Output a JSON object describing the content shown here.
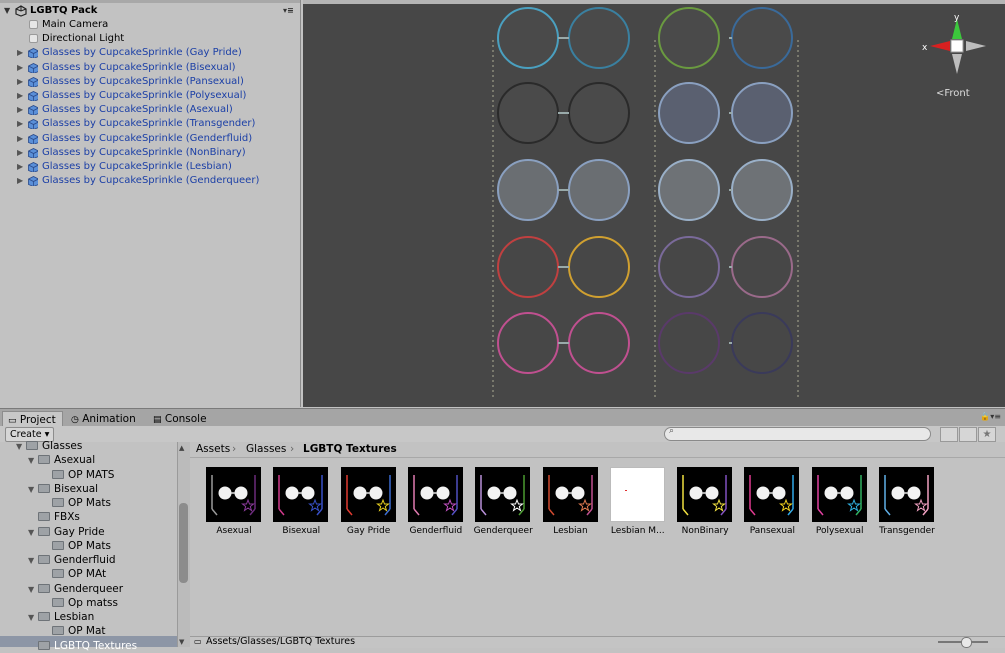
{
  "hierarchy": {
    "root": "LGBTQ Pack",
    "items": [
      {
        "label": "Main Camera",
        "prefab": false
      },
      {
        "label": "Directional Light",
        "prefab": false
      },
      {
        "label": "Glasses by CupcakeSprinkle (Gay Pride)",
        "prefab": true
      },
      {
        "label": "Glasses by CupcakeSprinkle (Bisexual)",
        "prefab": true
      },
      {
        "label": "Glasses by CupcakeSprinkle (Pansexual)",
        "prefab": true
      },
      {
        "label": "Glasses by CupcakeSprinkle (Polysexual)",
        "prefab": true
      },
      {
        "label": "Glasses by CupcakeSprinkle (Asexual)",
        "prefab": true
      },
      {
        "label": "Glasses by CupcakeSprinkle (Transgender)",
        "prefab": true
      },
      {
        "label": "Glasses by CupcakeSprinkle (Genderfluid)",
        "prefab": true
      },
      {
        "label": "Glasses by CupcakeSprinkle (NonBinary)",
        "prefab": true
      },
      {
        "label": "Glasses by CupcakeSprinkle (Lesbian)",
        "prefab": true
      },
      {
        "label": "Glasses by CupcakeSprinkle (Genderqueer)",
        "prefab": true
      }
    ]
  },
  "scene": {
    "gizmo": {
      "x": "x",
      "y": "y",
      "view": "Front"
    }
  },
  "tabs": [
    {
      "label": "Project",
      "active": true,
      "icon": "folder-icon"
    },
    {
      "label": "Animation",
      "active": false,
      "icon": "clock-icon"
    },
    {
      "label": "Console",
      "active": false,
      "icon": "console-icon"
    }
  ],
  "toolbar": {
    "create_label": "Create"
  },
  "folders": [
    {
      "label": "Glasses",
      "level": 1,
      "expanded": true
    },
    {
      "label": "Asexual",
      "level": 2,
      "expanded": true
    },
    {
      "label": "OP MATS",
      "level": 3
    },
    {
      "label": "Bisexual",
      "level": 2,
      "expanded": true
    },
    {
      "label": "OP Mats",
      "level": 3
    },
    {
      "label": "FBXs",
      "level": 2
    },
    {
      "label": "Gay Pride",
      "level": 2,
      "expanded": true
    },
    {
      "label": "OP Mats",
      "level": 3
    },
    {
      "label": "Genderfluid",
      "level": 2,
      "expanded": true
    },
    {
      "label": "OP MAt",
      "level": 3
    },
    {
      "label": "Genderqueer",
      "level": 2,
      "expanded": true
    },
    {
      "label": "Op matss",
      "level": 3
    },
    {
      "label": "Lesbian",
      "level": 2,
      "expanded": true
    },
    {
      "label": "OP Mat",
      "level": 3
    },
    {
      "label": "LGBTQ Textures",
      "level": 2
    }
  ],
  "breadcrumb": [
    "Assets",
    "Glasses",
    "LGBTQ Textures"
  ],
  "assets": [
    {
      "label": "Asexual",
      "star": "#8a3a9a",
      "c1": "#9a9a9a",
      "c2": "#6a2a7a"
    },
    {
      "label": "Bisexual",
      "star": "#3850c8",
      "c1": "#d03a8c",
      "c2": "#3850c8"
    },
    {
      "label": "Gay Pride",
      "star": "#e8d020",
      "c1": "#e03a30",
      "c2": "#3a6ad0"
    },
    {
      "label": "Genderfluid",
      "star": "#c050c0",
      "c1": "#e07ab0",
      "c2": "#5050c0"
    },
    {
      "label": "Genderqueer",
      "star": "#ffffff",
      "c1": "#b890d8",
      "c2": "#4a9a30"
    },
    {
      "label": "Lesbian",
      "star": "#e07a50",
      "c1": "#d04a30",
      "c2": "#c05090"
    },
    {
      "label": "Lesbian M...",
      "star": "",
      "c1": "",
      "c2": ""
    },
    {
      "label": "NonBinary",
      "star": "#f0e040",
      "c1": "#f0e040",
      "c2": "#8050c0"
    },
    {
      "label": "Pansexual",
      "star": "#f0d020",
      "c1": "#e03a90",
      "c2": "#30a8e8"
    },
    {
      "label": "Polysexual",
      "star": "#30b0e0",
      "c1": "#e040a0",
      "c2": "#30b060"
    },
    {
      "label": "Transgender",
      "star": "#f0a0c0",
      "c1": "#60b0e8",
      "c2": "#f0a0c0"
    }
  ],
  "status_path": "Assets/Glasses/LGBTQ Textures"
}
